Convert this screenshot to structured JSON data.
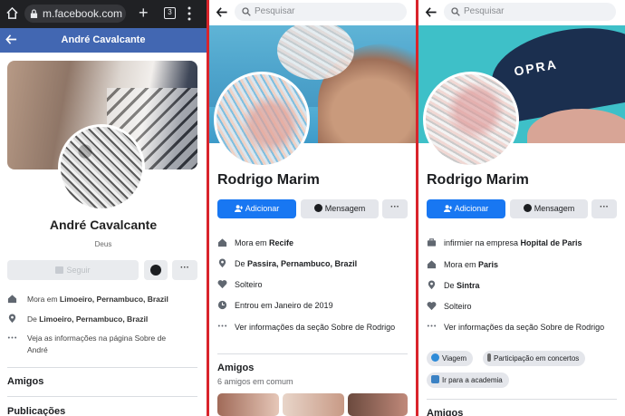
{
  "panel1": {
    "browser": {
      "url": "m.facebook.com",
      "tab_count": "3"
    },
    "header_title": "André Cavalcante",
    "name": "André Cavalcante",
    "bio": "Deus",
    "follow_label": "Seguir",
    "more_label": "···",
    "info": [
      {
        "icon": "home-icon",
        "prefix": "Mora em ",
        "bold": "Limoeiro, Pernambuco, Brazil"
      },
      {
        "icon": "location-pin-icon",
        "prefix": "De ",
        "bold": "Limoeiro, Pernambuco, Brazil"
      },
      {
        "icon": "more-dots-icon",
        "prefix": "Veja as informações na página Sobre de",
        "bold": ""
      },
      {
        "icon": "",
        "prefix": "André",
        "bold": ""
      }
    ],
    "sections": {
      "friends": "Amigos",
      "posts": "Publicações"
    }
  },
  "panel2": {
    "search_placeholder": "Pesquisar",
    "name": "Rodrigo Marim",
    "add_label": "Adicionar",
    "message_label": "Mensagem",
    "more_label": "···",
    "info": [
      {
        "icon": "home-icon",
        "prefix": "Mora em ",
        "bold": "Recife"
      },
      {
        "icon": "location-pin-icon",
        "prefix": "De ",
        "bold": "Passira, Pernambuco, Brazil"
      },
      {
        "icon": "heart-icon",
        "prefix": "Solteiro",
        "bold": ""
      },
      {
        "icon": "clock-icon",
        "prefix": "Entrou em Janeiro de 2019",
        "bold": ""
      },
      {
        "icon": "more-dots-icon",
        "prefix": "Ver informações da seção Sobre de Rodrigo",
        "bold": ""
      }
    ],
    "friends_title": "Amigos",
    "friends_common": "6 amigos em comum"
  },
  "panel3": {
    "search_placeholder": "Pesquisar",
    "name": "Rodrigo Marim",
    "add_label": "Adicionar",
    "message_label": "Mensagem",
    "more_label": "···",
    "cover_text": "OPRA",
    "info": [
      {
        "icon": "briefcase-icon",
        "prefix": "infirmier na empresa ",
        "bold": "Hopital de Paris"
      },
      {
        "icon": "home-icon",
        "prefix": "Mora em ",
        "bold": "Paris"
      },
      {
        "icon": "location-pin-icon",
        "prefix": "De ",
        "bold": "Sintra"
      },
      {
        "icon": "heart-icon",
        "prefix": "Solteiro",
        "bold": ""
      },
      {
        "icon": "more-dots-icon",
        "prefix": "Ver informações da seção Sobre de Rodrigo",
        "bold": ""
      }
    ],
    "chips": [
      {
        "label": "Viagem",
        "emoji_color": "#2e8bd8"
      },
      {
        "label": "Participação em concertos",
        "emoji_color": "#6b6b6b"
      },
      {
        "label": "Ir para a academia",
        "emoji_color": "#3b82c4"
      }
    ],
    "friends_title": "Amigos"
  }
}
